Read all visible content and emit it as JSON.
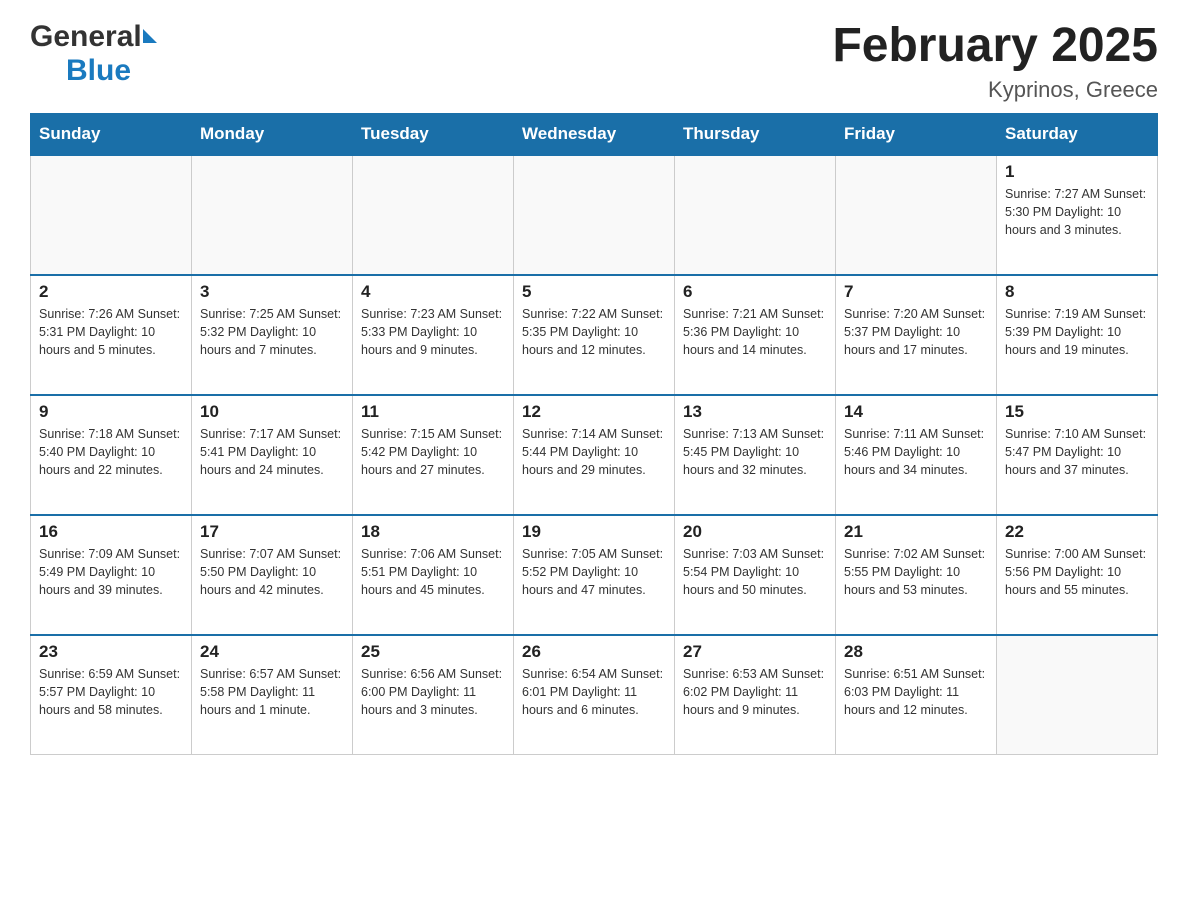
{
  "logo": {
    "general": "General",
    "blue": "Blue"
  },
  "title": {
    "month": "February 2025",
    "location": "Kyprinos, Greece"
  },
  "weekdays": [
    "Sunday",
    "Monday",
    "Tuesday",
    "Wednesday",
    "Thursday",
    "Friday",
    "Saturday"
  ],
  "weeks": [
    {
      "days": [
        {
          "num": "",
          "info": ""
        },
        {
          "num": "",
          "info": ""
        },
        {
          "num": "",
          "info": ""
        },
        {
          "num": "",
          "info": ""
        },
        {
          "num": "",
          "info": ""
        },
        {
          "num": "",
          "info": ""
        },
        {
          "num": "1",
          "info": "Sunrise: 7:27 AM\nSunset: 5:30 PM\nDaylight: 10 hours and 3 minutes."
        }
      ]
    },
    {
      "days": [
        {
          "num": "2",
          "info": "Sunrise: 7:26 AM\nSunset: 5:31 PM\nDaylight: 10 hours and 5 minutes."
        },
        {
          "num": "3",
          "info": "Sunrise: 7:25 AM\nSunset: 5:32 PM\nDaylight: 10 hours and 7 minutes."
        },
        {
          "num": "4",
          "info": "Sunrise: 7:23 AM\nSunset: 5:33 PM\nDaylight: 10 hours and 9 minutes."
        },
        {
          "num": "5",
          "info": "Sunrise: 7:22 AM\nSunset: 5:35 PM\nDaylight: 10 hours and 12 minutes."
        },
        {
          "num": "6",
          "info": "Sunrise: 7:21 AM\nSunset: 5:36 PM\nDaylight: 10 hours and 14 minutes."
        },
        {
          "num": "7",
          "info": "Sunrise: 7:20 AM\nSunset: 5:37 PM\nDaylight: 10 hours and 17 minutes."
        },
        {
          "num": "8",
          "info": "Sunrise: 7:19 AM\nSunset: 5:39 PM\nDaylight: 10 hours and 19 minutes."
        }
      ]
    },
    {
      "days": [
        {
          "num": "9",
          "info": "Sunrise: 7:18 AM\nSunset: 5:40 PM\nDaylight: 10 hours and 22 minutes."
        },
        {
          "num": "10",
          "info": "Sunrise: 7:17 AM\nSunset: 5:41 PM\nDaylight: 10 hours and 24 minutes."
        },
        {
          "num": "11",
          "info": "Sunrise: 7:15 AM\nSunset: 5:42 PM\nDaylight: 10 hours and 27 minutes."
        },
        {
          "num": "12",
          "info": "Sunrise: 7:14 AM\nSunset: 5:44 PM\nDaylight: 10 hours and 29 minutes."
        },
        {
          "num": "13",
          "info": "Sunrise: 7:13 AM\nSunset: 5:45 PM\nDaylight: 10 hours and 32 minutes."
        },
        {
          "num": "14",
          "info": "Sunrise: 7:11 AM\nSunset: 5:46 PM\nDaylight: 10 hours and 34 minutes."
        },
        {
          "num": "15",
          "info": "Sunrise: 7:10 AM\nSunset: 5:47 PM\nDaylight: 10 hours and 37 minutes."
        }
      ]
    },
    {
      "days": [
        {
          "num": "16",
          "info": "Sunrise: 7:09 AM\nSunset: 5:49 PM\nDaylight: 10 hours and 39 minutes."
        },
        {
          "num": "17",
          "info": "Sunrise: 7:07 AM\nSunset: 5:50 PM\nDaylight: 10 hours and 42 minutes."
        },
        {
          "num": "18",
          "info": "Sunrise: 7:06 AM\nSunset: 5:51 PM\nDaylight: 10 hours and 45 minutes."
        },
        {
          "num": "19",
          "info": "Sunrise: 7:05 AM\nSunset: 5:52 PM\nDaylight: 10 hours and 47 minutes."
        },
        {
          "num": "20",
          "info": "Sunrise: 7:03 AM\nSunset: 5:54 PM\nDaylight: 10 hours and 50 minutes."
        },
        {
          "num": "21",
          "info": "Sunrise: 7:02 AM\nSunset: 5:55 PM\nDaylight: 10 hours and 53 minutes."
        },
        {
          "num": "22",
          "info": "Sunrise: 7:00 AM\nSunset: 5:56 PM\nDaylight: 10 hours and 55 minutes."
        }
      ]
    },
    {
      "days": [
        {
          "num": "23",
          "info": "Sunrise: 6:59 AM\nSunset: 5:57 PM\nDaylight: 10 hours and 58 minutes."
        },
        {
          "num": "24",
          "info": "Sunrise: 6:57 AM\nSunset: 5:58 PM\nDaylight: 11 hours and 1 minute."
        },
        {
          "num": "25",
          "info": "Sunrise: 6:56 AM\nSunset: 6:00 PM\nDaylight: 11 hours and 3 minutes."
        },
        {
          "num": "26",
          "info": "Sunrise: 6:54 AM\nSunset: 6:01 PM\nDaylight: 11 hours and 6 minutes."
        },
        {
          "num": "27",
          "info": "Sunrise: 6:53 AM\nSunset: 6:02 PM\nDaylight: 11 hours and 9 minutes."
        },
        {
          "num": "28",
          "info": "Sunrise: 6:51 AM\nSunset: 6:03 PM\nDaylight: 11 hours and 12 minutes."
        },
        {
          "num": "",
          "info": ""
        }
      ]
    }
  ]
}
